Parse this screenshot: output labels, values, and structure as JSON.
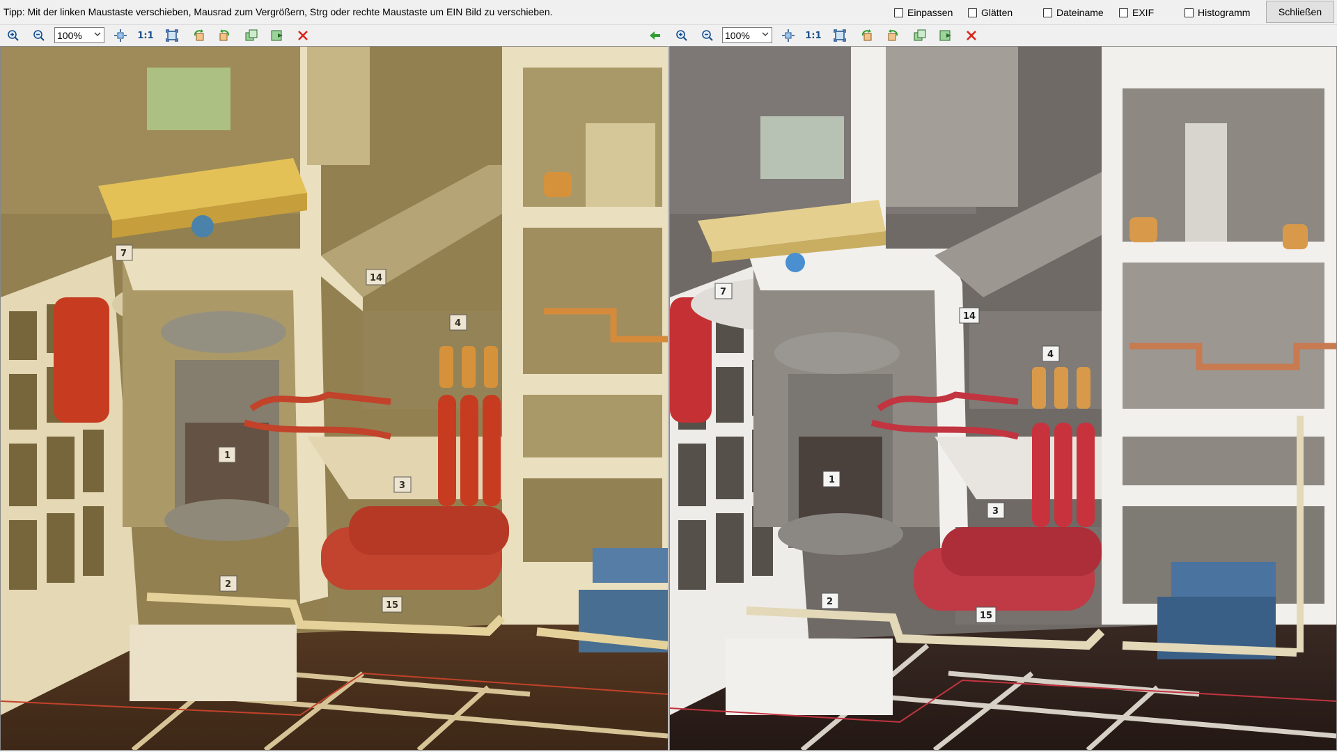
{
  "topbar": {
    "tip": "Tipp: Mit der linken Maustaste verschieben, Mausrad zum Vergrößern, Strg oder rechte Maustaste um EIN Bild zu verschieben.",
    "options": [
      {
        "label": "Einpassen",
        "checked": false
      },
      {
        "label": "Glätten",
        "checked": false
      },
      {
        "label": "Dateiname",
        "checked": false
      },
      {
        "label": "EXIF",
        "checked": false
      },
      {
        "label": "Histogramm",
        "checked": false
      }
    ],
    "close_label": "Schließen"
  },
  "viewer_left": {
    "zoom": "100%",
    "one_to_one": "1:1",
    "icons": [
      "zoom-in-icon",
      "zoom-out-icon",
      "fit-to-window-icon",
      "one-to-one-icon",
      "full-view-icon",
      "rotate-left-icon",
      "rotate-right-icon",
      "copy-image-icon",
      "save-image-icon",
      "close-image-icon",
      "sync-arrow-left-icon"
    ]
  },
  "viewer_right": {
    "zoom": "100%",
    "one_to_one": "1:1",
    "icons": [
      "zoom-in-icon",
      "zoom-out-icon",
      "fit-to-window-icon",
      "one-to-one-icon",
      "full-view-icon",
      "rotate-left-icon",
      "rotate-right-icon",
      "copy-image-icon",
      "save-image-icon",
      "close-image-icon"
    ]
  },
  "image_left": {
    "tone": "warm-yellow",
    "labels": [
      "7",
      "14",
      "4",
      "1",
      "3",
      "2",
      "15"
    ]
  },
  "image_right": {
    "tone": "neutral",
    "labels": [
      "7",
      "14",
      "4",
      "1",
      "3",
      "2",
      "15"
    ]
  },
  "colors": {
    "accent": "#1a4e8a",
    "close_red": "#d9261c",
    "arrow_green": "#2e9e2e"
  }
}
